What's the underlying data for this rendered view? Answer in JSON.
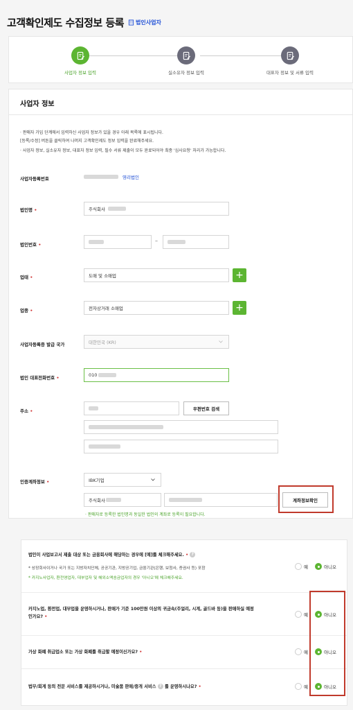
{
  "header": {
    "title": "고객확인제도 수집정보 등록",
    "badge": "법인사업자"
  },
  "steps": [
    {
      "label": "사업자 정보 입력",
      "state": "active"
    },
    {
      "label": "실소유자 정보 입력",
      "state": "todo"
    },
    {
      "label": "대표자 정보 및 서류 입력",
      "state": "todo"
    }
  ],
  "section": {
    "title": "사업자 정보"
  },
  "notices": [
    "· 판매자 가입 단계에서 입력하신 사업자 정보가 있을 경우 아래 목록에 표시됩니다.",
    "  [등록/수정] 버튼을 클릭하여 나머지 고객확인제도 정보 입력을 완료해주세요.",
    "· 사업자 정보, 실소유자 정보, 대표자 정보 입력, 필수 서류 제출이 모두 완료되어야 최종 '심사요청' 처리가 가능합니다."
  ],
  "fields": {
    "bizno": {
      "label": "사업자등록번호",
      "type": "영리법인"
    },
    "corp_name": {
      "label": "법인명",
      "value": "주식회사"
    },
    "corp_no": {
      "label": "법인번호"
    },
    "business_type": {
      "label": "업태",
      "value": "도매 및 소매업"
    },
    "business_item": {
      "label": "업종",
      "value": "전자상거래 소매업"
    },
    "country": {
      "label": "사업자등록증 발급 국가",
      "value": "대한민국 (KR)"
    },
    "phone": {
      "label": "법인 대표전화번호",
      "value": "010"
    },
    "address": {
      "label": "주소",
      "zip_button": "우편번호 검색"
    },
    "account": {
      "label": "인증계좌정보",
      "bank": "IBK기업",
      "holder": "주식회사",
      "verify_button": "계좌정보확인",
      "hint": "· 판매자로 등록한 법인명과 동일한 법인의 계좌로 등록이 필요합니다."
    }
  },
  "plus_symbol": "+",
  "dash": "–",
  "help_symbol": "?",
  "questions": [
    {
      "text": "법인이 사업보고서 제출 대상 또는 금융회사에 해당하는 경우에 [예]를 체크해주세요.",
      "sub1": "* 상장회사이거나 국가 또는 지방자치단체, 공공기관, 지방공기업, 금융기관(은행, 보험사, 증권사 등) 포함",
      "sub2": "* 카지노사업자, 환전영업자, 대부업자 및 해외소액송금업자의 경우 '아니오'에 체크해주세요.",
      "yes": "예",
      "no": "아니오",
      "selected": "no"
    },
    {
      "text": "카지노업, 환전업, 대부업을 운영하시거나, 판매가 기준 100만원 이상의 귀금속(주얼리, 시계, 골드바 등)을 판매하실 예정인가요?",
      "yes": "예",
      "no": "아니오",
      "selected": "no"
    },
    {
      "text": "가상 화폐 취급업소 또는 가상 화폐를 취급할 예정이신가요?",
      "yes": "예",
      "no": "아니오",
      "selected": "no"
    },
    {
      "text_a": "법무/회계 등의 전문 서비스를 제공하시거나, 미술품 판매/중개 서비스",
      "text_b": "를 운영하시나요?",
      "yes": "예",
      "no": "아니오",
      "selected": "no"
    }
  ],
  "colors": {
    "accent": "#5cb532",
    "link": "#1f4fd6",
    "required": "#d23b3b",
    "highlight": "#c0392b"
  }
}
